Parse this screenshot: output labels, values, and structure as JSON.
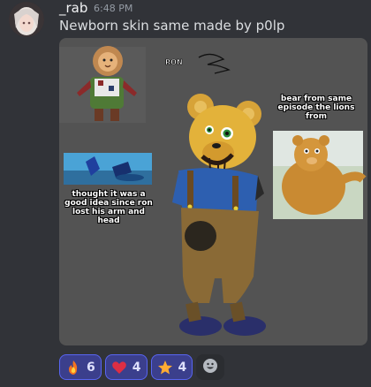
{
  "message": {
    "username": "_rab",
    "timestamp": "6:48 PM",
    "text": "Newborn skin same made by p0lp"
  },
  "image": {
    "label_ron": "RON",
    "caption_bear": "bear from same episode the lions from",
    "caption_thought": "thought it was a good idea since ron lost his arm and head"
  },
  "reactions": [
    {
      "emoji": "fire-icon",
      "count": "6"
    },
    {
      "emoji": "heart-icon",
      "count": "4"
    },
    {
      "emoji": "star-icon",
      "count": "4"
    }
  ],
  "colors": {
    "background": "#313338",
    "reaction_active_bg": "#3b3f8c",
    "reaction_active_border": "#5865f2",
    "attachment_bg": "#535353"
  }
}
